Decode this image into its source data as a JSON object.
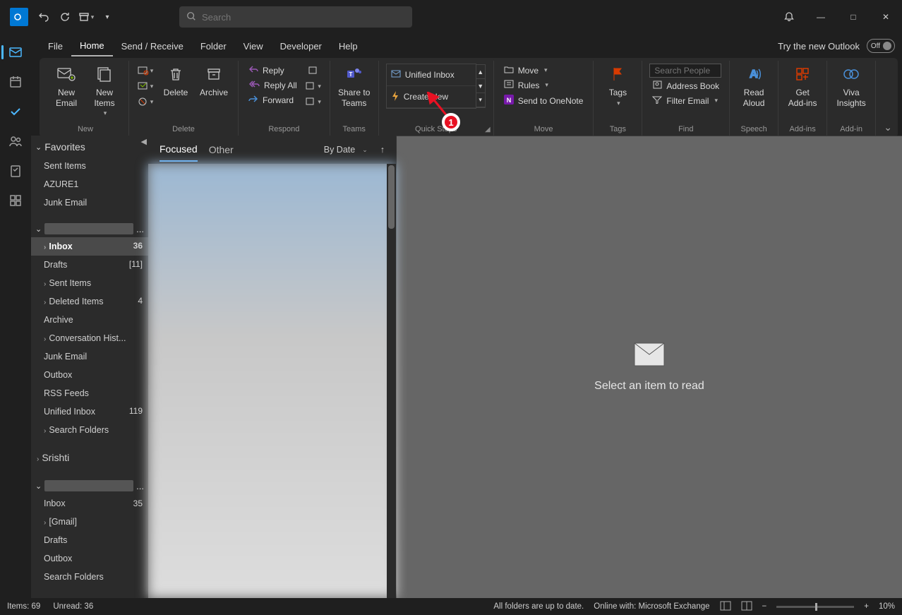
{
  "titlebar": {
    "search_placeholder": "Search"
  },
  "window": {
    "min": "—",
    "max": "□",
    "close": "✕"
  },
  "menutabs": [
    "File",
    "Home",
    "Send / Receive",
    "Folder",
    "View",
    "Developer",
    "Help"
  ],
  "menutab_active": 1,
  "try_new": {
    "label": "Try the new Outlook",
    "state": "Off"
  },
  "ribbon": {
    "new": {
      "label": "New",
      "new_email": "New\nEmail",
      "new_items": "New\nItems"
    },
    "delete": {
      "label": "Delete",
      "delete_btn": "Delete",
      "archive": "Archive"
    },
    "respond": {
      "label": "Respond",
      "reply": "Reply",
      "reply_all": "Reply All",
      "forward": "Forward"
    },
    "teams": {
      "label": "Teams",
      "share": "Share to\nTeams"
    },
    "quick_steps": {
      "label": "Quick Steps",
      "item1": "Unified Inbox",
      "item2": "Create New"
    },
    "move": {
      "label": "Move",
      "move_btn": "Move",
      "rules": "Rules",
      "onenote": "Send to OneNote"
    },
    "tags": {
      "label": "Tags",
      "btn": "Tags"
    },
    "find": {
      "label": "Find",
      "search_people_placeholder": "Search People",
      "addr": "Address Book",
      "filter": "Filter Email"
    },
    "speech": {
      "label": "Speech",
      "btn": "Read\nAloud"
    },
    "addins": {
      "label": "Add-ins",
      "btn": "Get\nAdd-ins"
    },
    "viva": {
      "label": "Add-in",
      "btn": "Viva\nInsights"
    }
  },
  "nav": {
    "favorites": "Favorites",
    "fav_items": [
      "Sent Items",
      "AZURE1",
      "Junk Email"
    ],
    "acct1": {
      "items": [
        {
          "name": "Inbox",
          "count": "36",
          "sel": true,
          "exp": true
        },
        {
          "name": "Drafts",
          "count": "[11]"
        },
        {
          "name": "Sent Items",
          "exp": true
        },
        {
          "name": "Deleted Items",
          "count": "4",
          "exp": true
        },
        {
          "name": "Archive"
        },
        {
          "name": "Conversation Hist...",
          "exp": true
        },
        {
          "name": "Junk Email"
        },
        {
          "name": "Outbox"
        },
        {
          "name": "RSS Feeds"
        },
        {
          "name": "Unified Inbox",
          "count": "119"
        },
        {
          "name": "Search Folders",
          "exp": true
        }
      ],
      "extra": "Srishti"
    },
    "acct2": {
      "items": [
        {
          "name": "Inbox",
          "count": "35"
        },
        {
          "name": "[Gmail]",
          "exp": true
        },
        {
          "name": "Drafts"
        },
        {
          "name": "Outbox"
        },
        {
          "name": "Search Folders"
        }
      ]
    }
  },
  "msglist": {
    "focused": "Focused",
    "other": "Other",
    "sort": "By Date"
  },
  "reading": {
    "empty": "Select an item to read"
  },
  "status": {
    "items": "Items: 69",
    "unread": "Unread: 36",
    "sync": "All folders are up to date.",
    "conn": "Online with: Microsoft Exchange",
    "zoom": "10%"
  },
  "annotation": {
    "num": "1"
  }
}
